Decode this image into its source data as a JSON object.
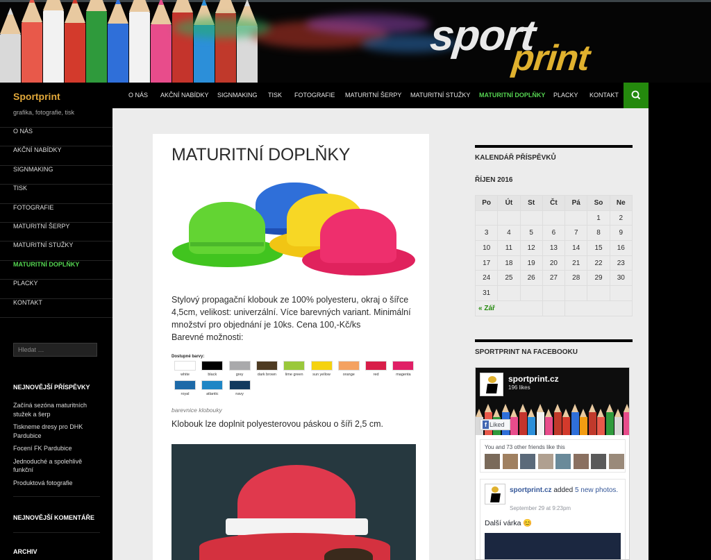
{
  "brand": {
    "logo_line1": "sport",
    "logo_line2": "print",
    "accent": "#24890d",
    "title_color": "#e1a83a",
    "logo_gold": "#e0b12e"
  },
  "site": {
    "title": "Sportprint",
    "description": "grafika, fotografie, tisk"
  },
  "nav": {
    "items": [
      "O NÁS",
      "AKČNÍ NABÍDKY",
      "SIGNMAKING",
      "TISK",
      "FOTOGRAFIE",
      "MATURITNÍ ŠERPY",
      "MATURITNÍ STUŽKY",
      "MATURITNÍ DOPLŇKY",
      "PLACKY",
      "KONTAKT"
    ],
    "active_index": 7,
    "search_icon": "search-icon"
  },
  "sidebar": {
    "menu": [
      "O NÁS",
      "AKČNÍ NABÍDKY",
      "SIGNMAKING",
      "TISK",
      "FOTOGRAFIE",
      "MATURITNÍ ŠERPY",
      "MATURITNÍ STUŽKY",
      "MATURITNÍ DOPLŇKY",
      "PLACKY",
      "KONTAKT"
    ],
    "search_placeholder": "Hledat …",
    "recent_posts_heading": "NEJNOVĚJŠÍ PŘÍSPĚVKY",
    "recent_posts": [
      "Začíná sezóna maturitních stužek a šerp",
      "Tiskneme dresy pro DHK Pardubice",
      "Focení FK Pardubice",
      "Jednoduché a spolehlivě funkční",
      "Produktová fotografie"
    ],
    "recent_comments_heading": "NEJNOVĚJŠÍ KOMENTÁŘE",
    "archive_heading": "ARCHIV"
  },
  "article": {
    "title": "MATURITNÍ DOPLŇKY",
    "paragraph1": "Stylový propagační klobouk ze 100% polyesteru, okraj o šířce 4,5cm, velikost: univerzální. Více barevných variant. Minimální množství pro objednání je 10ks. Cena 100,-Kč/ks",
    "paragraph1b": "Barevné možnosti:",
    "swatch_title": "Dostupné barvy:",
    "swatches": [
      {
        "name": "white",
        "color": "#ffffff"
      },
      {
        "name": "black",
        "color": "#000000"
      },
      {
        "name": "grey",
        "color": "#a9a9ab"
      },
      {
        "name": "dark brown",
        "color": "#4e3b22"
      },
      {
        "name": "lime green",
        "color": "#9ac83b"
      },
      {
        "name": "sun yellow",
        "color": "#f5d20f"
      },
      {
        "name": "orange",
        "color": "#f4a261"
      },
      {
        "name": "red",
        "color": "#d81e49"
      },
      {
        "name": "magenta",
        "color": "#e01f66"
      },
      {
        "name": "royal",
        "color": "#1e6aa8"
      },
      {
        "name": "atlantic",
        "color": "#1f86c5"
      },
      {
        "name": "navy",
        "color": "#123a5e"
      }
    ],
    "caption": "barevnice klobouky",
    "paragraph2": "Klobouk lze doplnit polyesterovou páskou o šíři 2,5 cm."
  },
  "calendar": {
    "heading": "KALENDÁŘ PŘÍSPĚVKŮ",
    "month": "ŘÍJEN 2016",
    "weekdays": [
      "Po",
      "Út",
      "St",
      "Čt",
      "Pá",
      "So",
      "Ne"
    ],
    "weeks": [
      [
        "",
        "",
        "",
        "",
        "",
        "1",
        "2"
      ],
      [
        "3",
        "4",
        "5",
        "6",
        "7",
        "8",
        "9"
      ],
      [
        "10",
        "11",
        "12",
        "13",
        "14",
        "15",
        "16"
      ],
      [
        "17",
        "18",
        "19",
        "20",
        "21",
        "22",
        "23"
      ],
      [
        "24",
        "25",
        "26",
        "27",
        "28",
        "29",
        "30"
      ],
      [
        "31",
        "",
        "",
        "",
        "",
        "",
        ""
      ]
    ],
    "prev_link": "« Zář"
  },
  "facebook": {
    "heading": "SPORTPRINT NA FACEBOOKU",
    "page_name": "sportprint.cz",
    "likes": "196 likes",
    "liked_button": "Liked",
    "friends_text": "You and 73 other friends like this",
    "post_author": "sportprint.cz",
    "post_action": " added ",
    "post_link": "5 new photos.",
    "post_date": "September 29 at 9:23pm",
    "post_message": "Další várka 😊"
  }
}
